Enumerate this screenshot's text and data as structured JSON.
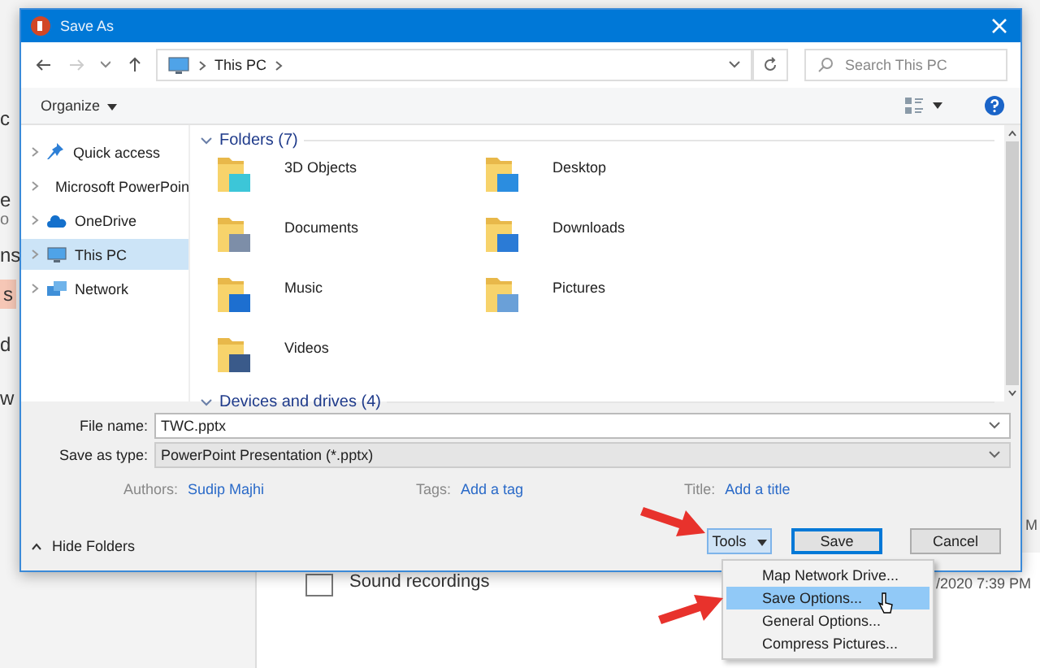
{
  "backdrop": {
    "fragments": [
      {
        "text": "c",
        "kind": "plain"
      },
      {
        "text": "e",
        "kind": "plain"
      },
      {
        "text": "o",
        "kind": "small"
      },
      {
        "text": "ns",
        "kind": "plain"
      },
      {
        "text": "s",
        "kind": "highlight"
      },
      {
        "text": "d",
        "kind": "plain"
      },
      {
        "text": "w",
        "kind": "plain"
      }
    ],
    "recent_item": {
      "label": "Sound recordings",
      "checked": false
    },
    "date": "/2020 7:39 PM",
    "edge_text": "M"
  },
  "window": {
    "title": "Save As"
  },
  "address": {
    "path": "This PC",
    "search_placeholder": "Search This PC"
  },
  "toolbar": {
    "organize": "Organize"
  },
  "nav": [
    {
      "label": "Quick access",
      "selected": false
    },
    {
      "label": "Microsoft PowerPoin",
      "selected": false
    },
    {
      "label": "OneDrive",
      "selected": false
    },
    {
      "label": "This PC",
      "selected": true
    },
    {
      "label": "Network",
      "selected": false
    }
  ],
  "folders": {
    "title": "Folders (7)",
    "items": [
      "3D Objects",
      "Desktop",
      "Documents",
      "Downloads",
      "Music",
      "Pictures",
      "Videos"
    ]
  },
  "drives": {
    "title": "Devices and drives (4)"
  },
  "form": {
    "file_name_label": "File name:",
    "file_name": "TWC.pptx",
    "type_label": "Save as type:",
    "type": "PowerPoint Presentation (*.pptx)",
    "meta": [
      {
        "label": "Authors:",
        "value": "Sudip Majhi"
      },
      {
        "label": "Tags:",
        "value": "Add a tag"
      },
      {
        "label": "Title:",
        "value": "Add a title"
      }
    ]
  },
  "hide_folders": "Hide Folders",
  "buttons": {
    "tools": "Tools",
    "save": "Save",
    "cancel": "Cancel"
  },
  "menu": [
    {
      "label": "Map Network Drive...",
      "selected": false
    },
    {
      "label": "Save Options...",
      "selected": true
    },
    {
      "label": "General Options...",
      "selected": false
    },
    {
      "label": "Compress Pictures...",
      "selected": false
    }
  ]
}
